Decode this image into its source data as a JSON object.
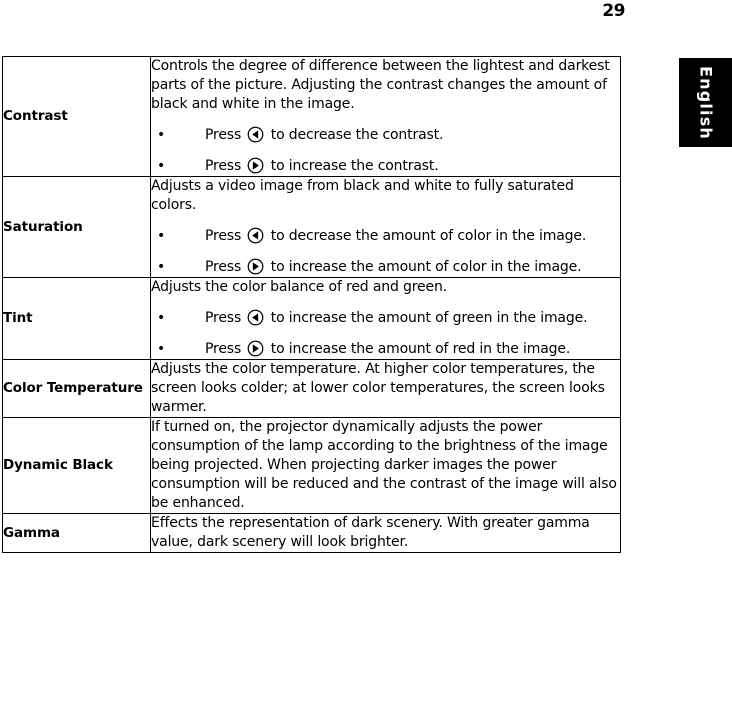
{
  "page": {
    "number": "29"
  },
  "side_tab": {
    "label": "English"
  },
  "table": {
    "rows": [
      {
        "label": "Contrast",
        "intro": "Controls the degree of difference between the lightest and darkest parts of the picture. Adjusting the contrast changes the amount of black and white in the image.",
        "bullets": [
          {
            "bullet": "•",
            "pre": "Press",
            "icon": "left-arrow-key-icon",
            "post": "to decrease the contrast."
          },
          {
            "bullet": "•",
            "pre": "Press",
            "icon": "right-arrow-key-icon",
            "post": "to increase the contrast."
          }
        ]
      },
      {
        "label": "Saturation",
        "intro": "Adjusts a video image from black and white to fully saturated colors.",
        "bullets": [
          {
            "bullet": "•",
            "pre": "Press",
            "icon": "left-arrow-key-icon",
            "post": "to decrease the amount of color in the image."
          },
          {
            "bullet": "•",
            "pre": "Press",
            "icon": "right-arrow-key-icon",
            "post": "to increase the amount of color in the image."
          }
        ]
      },
      {
        "label": "Tint",
        "intro": "Adjusts the color balance of red and green.",
        "bullets": [
          {
            "bullet": "•",
            "pre": "Press",
            "icon": "left-arrow-key-icon",
            "post": "to increase the amount of green in the image."
          },
          {
            "bullet": "•",
            "pre": "Press",
            "icon": "right-arrow-key-icon",
            "post": "to increase the amount of red in the image."
          }
        ]
      },
      {
        "label": "Color Temperature",
        "intro": "Adjusts the color temperature. At higher color temperatures, the screen looks colder; at lower color temperatures, the screen looks warmer.",
        "bullets": []
      },
      {
        "label": "Dynamic Black",
        "intro": "If turned on, the projector dynamically adjusts the power consumption of the lamp according to the brightness of the image being projected. When projecting darker images the power consumption will be reduced and the contrast of the image will also be enhanced.",
        "bullets": []
      },
      {
        "label": "Gamma",
        "intro": "Effects the representation of dark scenery. With greater gamma value, dark scenery will look brighter.",
        "bullets": []
      }
    ]
  },
  "colors": {
    "ink": "#000000",
    "paper": "#ffffff",
    "tab_background": "#000000",
    "tab_text": "#ffffff"
  }
}
